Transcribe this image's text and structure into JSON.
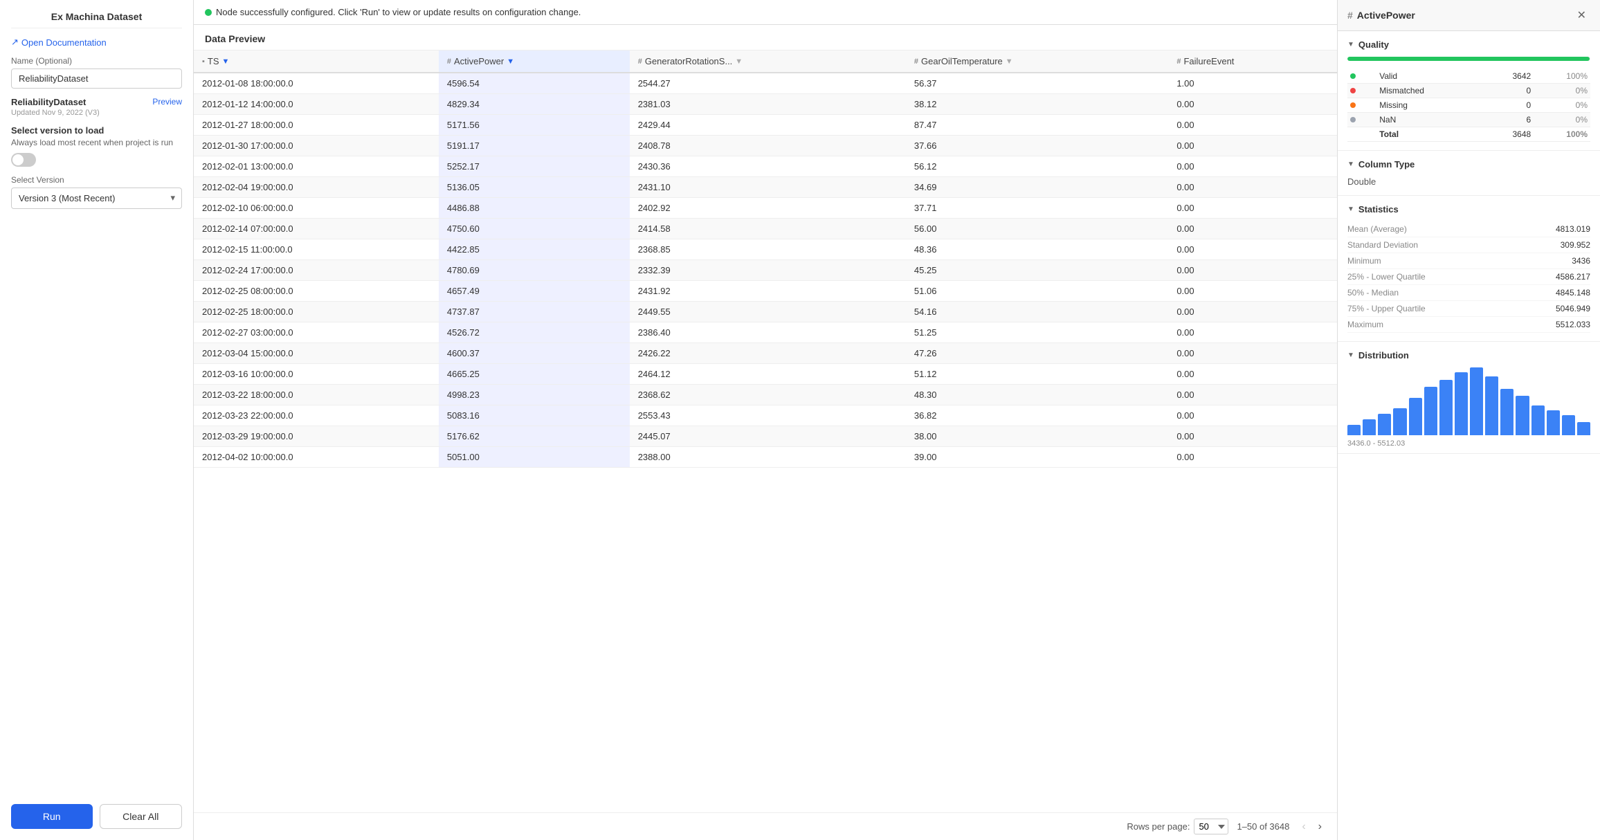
{
  "sidebar": {
    "title": "Ex Machina Dataset",
    "open_doc_label": "Open Documentation",
    "name_field_label": "Name (Optional)",
    "name_field_value": "ReliabilityDataset",
    "dataset_name": "ReliabilityDataset",
    "dataset_updated": "Updated Nov 9, 2022 (V3)",
    "preview_label": "Preview",
    "select_version_title": "Select version to load",
    "select_version_desc": "Always load most recent when project is run",
    "select_version_label": "Select Version",
    "select_version_value": "Version 3 (Most Recent)",
    "run_label": "Run",
    "clear_label": "Clear All"
  },
  "notification": {
    "text": "Node successfully configured. Click 'Run' to view or update results on configuration change."
  },
  "data_preview": {
    "title": "Data Preview",
    "columns": [
      {
        "name": "TS",
        "type": "T",
        "has_filter": true,
        "is_active": false
      },
      {
        "name": "ActivePower",
        "type": "#",
        "has_filter": true,
        "is_active": true
      },
      {
        "name": "GeneratorRotationS...",
        "type": "#",
        "has_filter": true,
        "is_active": false
      },
      {
        "name": "GearOilTemperature",
        "type": "#",
        "has_filter": true,
        "is_active": false
      },
      {
        "name": "FailureEvent",
        "type": "#",
        "has_filter": false,
        "is_active": false
      }
    ],
    "rows": [
      [
        "2012-01-08 18:00:00.0",
        "4596.54",
        "2544.27",
        "56.37",
        "1.00"
      ],
      [
        "2012-01-12 14:00:00.0",
        "4829.34",
        "2381.03",
        "38.12",
        "0.00"
      ],
      [
        "2012-01-27 18:00:00.0",
        "5171.56",
        "2429.44",
        "87.47",
        "0.00"
      ],
      [
        "2012-01-30 17:00:00.0",
        "5191.17",
        "2408.78",
        "37.66",
        "0.00"
      ],
      [
        "2012-02-01 13:00:00.0",
        "5252.17",
        "2430.36",
        "56.12",
        "0.00"
      ],
      [
        "2012-02-04 19:00:00.0",
        "5136.05",
        "2431.10",
        "34.69",
        "0.00"
      ],
      [
        "2012-02-10 06:00:00.0",
        "4486.88",
        "2402.92",
        "37.71",
        "0.00"
      ],
      [
        "2012-02-14 07:00:00.0",
        "4750.60",
        "2414.58",
        "56.00",
        "0.00"
      ],
      [
        "2012-02-15 11:00:00.0",
        "4422.85",
        "2368.85",
        "48.36",
        "0.00"
      ],
      [
        "2012-02-24 17:00:00.0",
        "4780.69",
        "2332.39",
        "45.25",
        "0.00"
      ],
      [
        "2012-02-25 08:00:00.0",
        "4657.49",
        "2431.92",
        "51.06",
        "0.00"
      ],
      [
        "2012-02-25 18:00:00.0",
        "4737.87",
        "2449.55",
        "54.16",
        "0.00"
      ],
      [
        "2012-02-27 03:00:00.0",
        "4526.72",
        "2386.40",
        "51.25",
        "0.00"
      ],
      [
        "2012-03-04 15:00:00.0",
        "4600.37",
        "2426.22",
        "47.26",
        "0.00"
      ],
      [
        "2012-03-16 10:00:00.0",
        "4665.25",
        "2464.12",
        "51.12",
        "0.00"
      ],
      [
        "2012-03-22 18:00:00.0",
        "4998.23",
        "2368.62",
        "48.30",
        "0.00"
      ],
      [
        "2012-03-23 22:00:00.0",
        "5083.16",
        "2553.43",
        "36.82",
        "0.00"
      ],
      [
        "2012-03-29 19:00:00.0",
        "5176.62",
        "2445.07",
        "38.00",
        "0.00"
      ],
      [
        "2012-04-02 10:00:00.0",
        "5051.00",
        "2388.00",
        "39.00",
        "0.00"
      ]
    ],
    "footer": {
      "rows_per_page_label": "Rows per page:",
      "rows_per_page_value": "50",
      "page_info": "1–50 of 3648"
    }
  },
  "right_panel": {
    "title": "ActivePower",
    "quality": {
      "section_title": "Quality",
      "bar_percent": 99.8,
      "rows": [
        {
          "label": "Valid",
          "dot": "green",
          "value": "3642",
          "pct": "100%"
        },
        {
          "label": "Mismatched",
          "dot": "red",
          "value": "0",
          "pct": "0%"
        },
        {
          "label": "Missing",
          "dot": "orange",
          "value": "0",
          "pct": "0%"
        },
        {
          "label": "NaN",
          "dot": "gray",
          "value": "6",
          "pct": "0%"
        }
      ],
      "total_label": "Total",
      "total_value": "3648",
      "total_pct": "100%"
    },
    "column_type": {
      "section_title": "Column Type",
      "value": "Double"
    },
    "statistics": {
      "section_title": "Statistics",
      "rows": [
        {
          "label": "Mean (Average)",
          "value": "4813.019"
        },
        {
          "label": "Standard Deviation",
          "value": "309.952"
        },
        {
          "label": "Minimum",
          "value": "3436"
        },
        {
          "label": "25% - Lower Quartile",
          "value": "4586.217"
        },
        {
          "label": "50% - Median",
          "value": "4845.148"
        },
        {
          "label": "75% - Upper Quartile",
          "value": "5046.949"
        },
        {
          "label": "Maximum",
          "value": "5512.033"
        }
      ]
    },
    "distribution": {
      "section_title": "Distribution",
      "range": "3436.0 - 5512.03",
      "bars": [
        15,
        22,
        30,
        38,
        52,
        68,
        78,
        88,
        95,
        82,
        65,
        55,
        42,
        35,
        28,
        18
      ]
    }
  }
}
